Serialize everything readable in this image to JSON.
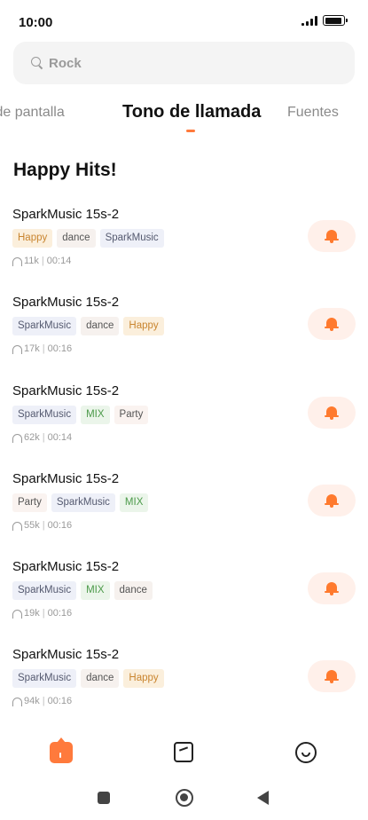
{
  "status_bar": {
    "time": "10:00"
  },
  "search": {
    "placeholder": "Rock"
  },
  "tabs": [
    {
      "label": "s de pantalla"
    },
    {
      "label": "Tono de llamada",
      "active": true
    },
    {
      "label": "Fuentes"
    }
  ],
  "section": {
    "title": "Happy Hits!"
  },
  "ringtones": [
    {
      "title": "SparkMusic 15s-2",
      "tags": [
        "Happy",
        "dance",
        "SparkMusic"
      ],
      "plays": "11k",
      "duration": "00:14"
    },
    {
      "title": "SparkMusic 15s-2",
      "tags": [
        "SparkMusic",
        "dance",
        "Happy"
      ],
      "plays": "17k",
      "duration": "00:16"
    },
    {
      "title": "SparkMusic 15s-2",
      "tags": [
        "SparkMusic",
        "MIX",
        "Party"
      ],
      "plays": "62k",
      "duration": "00:14"
    },
    {
      "title": "SparkMusic 15s-2",
      "tags": [
        "Party",
        "SparkMusic",
        "MIX"
      ],
      "plays": "55k",
      "duration": "00:16"
    },
    {
      "title": "SparkMusic 15s-2",
      "tags": [
        "SparkMusic",
        "MIX",
        "dance"
      ],
      "plays": "19k",
      "duration": "00:16"
    },
    {
      "title": "SparkMusic 15s-2",
      "tags": [
        "SparkMusic",
        "dance",
        "Happy"
      ],
      "plays": "94k",
      "duration": "00:16"
    }
  ],
  "tag_styles": {
    "Happy": {
      "bg": "#fbefdc",
      "fg": "#c9852f"
    },
    "dance": {
      "bg": "#f6f1ee",
      "fg": "#555555"
    },
    "SparkMusic": {
      "bg": "#eef0f8",
      "fg": "#555a70"
    },
    "MIX": {
      "bg": "#ebf5ea",
      "fg": "#4c9a4a"
    },
    "Party": {
      "bg": "#faf3f0",
      "fg": "#555555"
    }
  },
  "colors": {
    "accent": "#ff7a3c",
    "bell": "#ff7a2e",
    "bell_bg": "#fff0ea"
  },
  "icons": {
    "nav": [
      "home-icon",
      "bookmark-icon",
      "smiley-icon"
    ],
    "system": [
      "recents-icon",
      "home-circle-icon",
      "back-icon"
    ]
  }
}
